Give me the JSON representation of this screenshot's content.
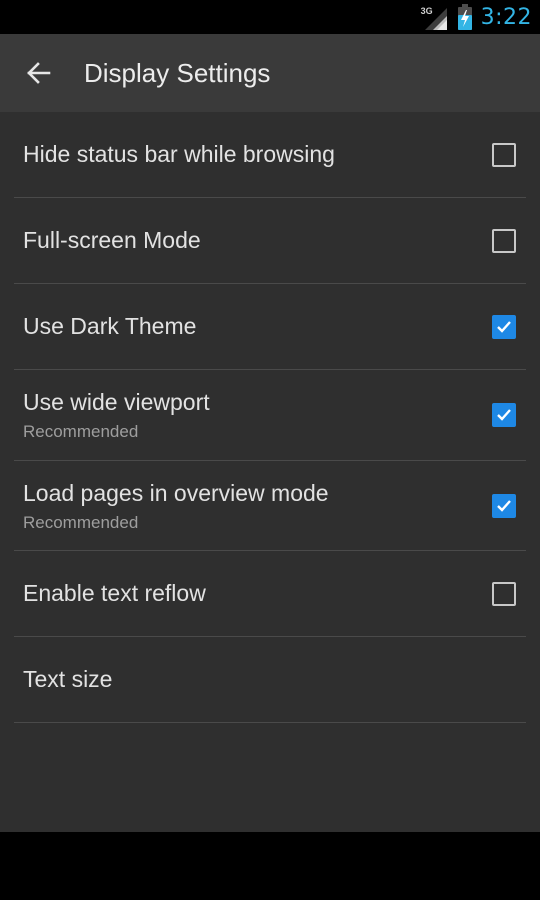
{
  "status_bar": {
    "network": "3G",
    "time": "3:22",
    "clock_color": "#33b5e5",
    "icons": [
      "signal-icon",
      "battery-charging-icon"
    ]
  },
  "action_bar": {
    "back_icon": "arrow-left-icon",
    "title": "Display Settings"
  },
  "settings": [
    {
      "label": "Hide status bar while browsing",
      "summary": "",
      "checkbox": true,
      "checked": false
    },
    {
      "label": "Full-screen Mode",
      "summary": "",
      "checkbox": true,
      "checked": false
    },
    {
      "label": "Use Dark Theme",
      "summary": "",
      "checkbox": true,
      "checked": true
    },
    {
      "label": "Use wide viewport",
      "summary": "Recommended",
      "checkbox": true,
      "checked": true
    },
    {
      "label": "Load pages in overview mode",
      "summary": "Recommended",
      "checkbox": true,
      "checked": true
    },
    {
      "label": "Enable text reflow",
      "summary": "",
      "checkbox": true,
      "checked": false
    },
    {
      "label": "Text size",
      "summary": "",
      "checkbox": false,
      "checked": false
    }
  ],
  "colors": {
    "accent": "#1e88e5",
    "background": "#2f2f2f",
    "action_bar": "#3a3a3a",
    "divider": "#4a4a4a"
  }
}
